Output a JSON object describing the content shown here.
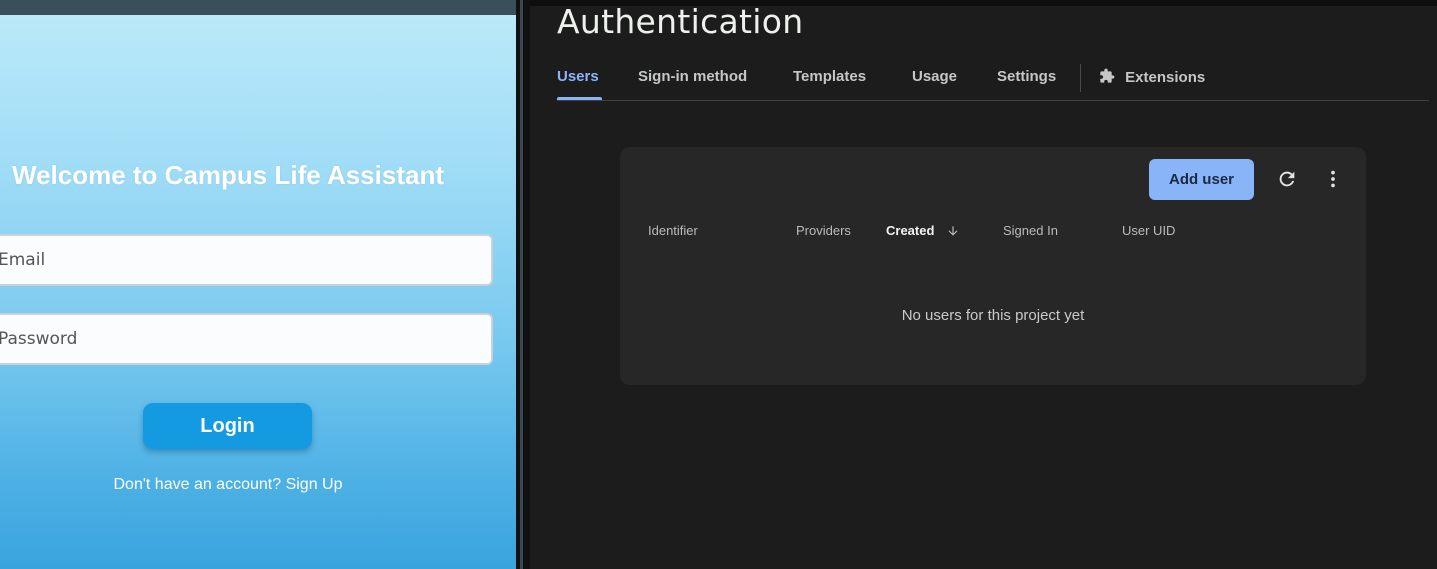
{
  "mobile_app": {
    "title": "Welcome to Campus Life Assistant",
    "email_placeholder": "Email",
    "password_placeholder": "Password",
    "login_label": "Login",
    "signup_text": "Don't have an account? Sign Up"
  },
  "console": {
    "title": "Authentication",
    "tabs": [
      {
        "label": "Users",
        "active": true
      },
      {
        "label": "Sign-in method"
      },
      {
        "label": "Templates"
      },
      {
        "label": "Usage"
      },
      {
        "label": "Settings"
      },
      {
        "label": "Extensions",
        "icon": "puzzle-icon"
      }
    ],
    "users_table": {
      "add_user_label": "Add user",
      "columns": [
        "Identifier",
        "Providers",
        "Created",
        "Signed In",
        "User UID"
      ],
      "sorted_column": "Created",
      "sort_direction": "descending",
      "empty_message": "No users for this project yet"
    }
  },
  "colors": {
    "accent": "#8ab4f8",
    "login_button": "#149ae0",
    "console_bg": "#1b1c1b",
    "card_bg": "#262726"
  }
}
